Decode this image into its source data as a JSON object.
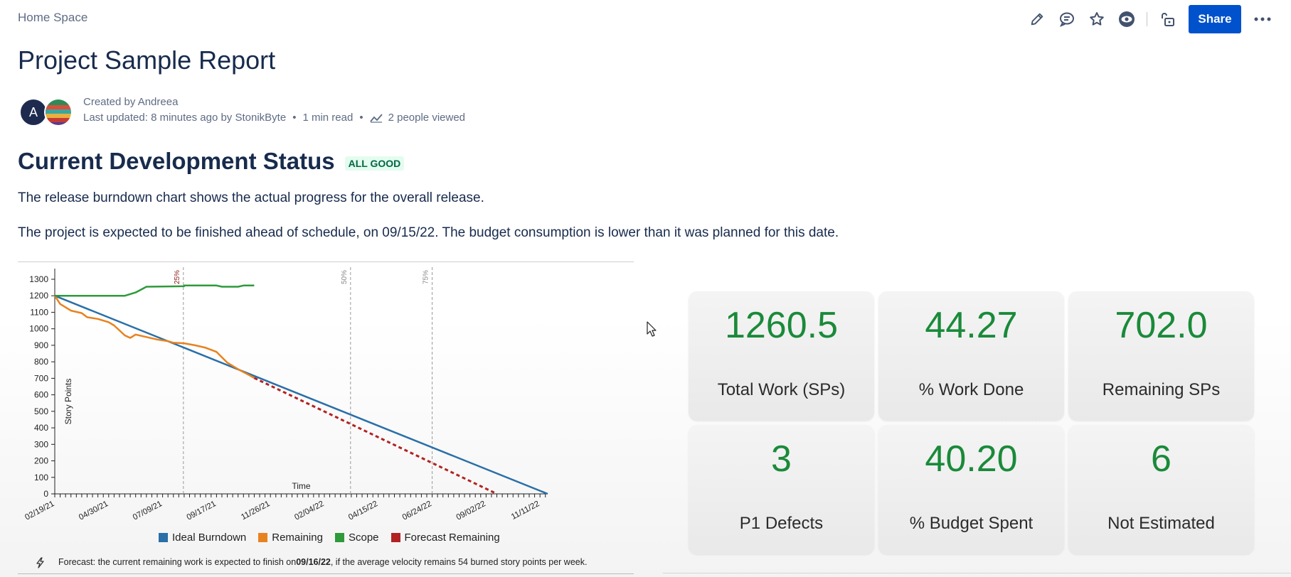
{
  "header": {
    "space_link": "Home Space",
    "share_label": "Share",
    "icons": [
      "edit-icon",
      "comment-icon",
      "star-icon",
      "watch-eye-icon",
      "unlock-icon",
      "more-icon"
    ]
  },
  "page": {
    "title": "Project Sample Report",
    "byline": {
      "avatar_initial": "A",
      "created": "Created by Andreea",
      "updated": "Last updated: 8 minutes ago by StonikByte",
      "read_time": "1 min read",
      "views": "2 people viewed"
    },
    "section_heading": "Current Development Status",
    "status_lozenge": "ALL GOOD",
    "status_colors": {
      "text": "#006644",
      "background": "#e3fcef"
    },
    "paragraph_1": "The release burndown chart shows the actual progress for the overall release.",
    "paragraph_2": "The project is expected to be finished ahead of schedule, on 09/15/22. The budget consumption is lower than it was planned for this date."
  },
  "chart_data": {
    "type": "line",
    "title": "",
    "xlabel": "Time",
    "ylabel": "Story Points",
    "ylim": [
      0,
      1300
    ],
    "yticks": [
      0,
      100,
      200,
      300,
      400,
      500,
      600,
      700,
      800,
      900,
      1000,
      1100,
      1200,
      1300
    ],
    "x_tick_labels": [
      "02/19/21",
      "04/30/21",
      "07/09/21",
      "09/17/21",
      "11/26/21",
      "02/04/22",
      "04/15/22",
      "06/24/22",
      "09/02/22",
      "11/11/22"
    ],
    "milestones": [
      {
        "label": "25%",
        "date": "08/05/21",
        "color": "#8b1a1a"
      },
      {
        "label": "50%",
        "date": "03/10/22",
        "color": "#888888"
      },
      {
        "label": "75%",
        "date": "06/24/22",
        "color": "#888888"
      }
    ],
    "grid": true,
    "legend_position": "bottom",
    "series": [
      {
        "name": "Ideal Burndown",
        "color": "#2a6fa8",
        "style": "solid",
        "points": [
          [
            "02/19/21",
            1200
          ],
          [
            "11/21/22",
            0
          ]
        ]
      },
      {
        "name": "Remaining",
        "color": "#e8821e",
        "style": "solid",
        "points": [
          [
            "02/19/21",
            1200
          ],
          [
            "02/26/21",
            1150
          ],
          [
            "03/12/21",
            1110
          ],
          [
            "03/26/21",
            1095
          ],
          [
            "04/02/21",
            1070
          ],
          [
            "04/16/21",
            1060
          ],
          [
            "04/30/21",
            1040
          ],
          [
            "05/07/21",
            1020
          ],
          [
            "05/14/21",
            990
          ],
          [
            "05/21/21",
            960
          ],
          [
            "05/28/21",
            945
          ],
          [
            "06/04/21",
            965
          ],
          [
            "06/18/21",
            950
          ],
          [
            "07/02/21",
            935
          ],
          [
            "07/16/21",
            925
          ],
          [
            "07/23/21",
            915
          ],
          [
            "08/06/21",
            912
          ],
          [
            "08/20/21",
            900
          ],
          [
            "09/03/21",
            885
          ],
          [
            "09/17/21",
            860
          ],
          [
            "10/01/21",
            795
          ],
          [
            "10/15/21",
            755
          ],
          [
            "10/29/21",
            720
          ],
          [
            "11/05/21",
            702
          ]
        ]
      },
      {
        "name": "Scope",
        "color": "#2e9a3a",
        "style": "solid",
        "points": [
          [
            "02/19/21",
            1200
          ],
          [
            "05/21/21",
            1200
          ],
          [
            "06/04/21",
            1220
          ],
          [
            "06/18/21",
            1255
          ],
          [
            "08/06/21",
            1258
          ],
          [
            "08/06/21",
            1262
          ],
          [
            "09/17/21",
            1262
          ],
          [
            "09/24/21",
            1255
          ],
          [
            "10/15/21",
            1255
          ],
          [
            "10/22/21",
            1262
          ],
          [
            "11/05/21",
            1262
          ]
        ]
      },
      {
        "name": "Forecast Remaining",
        "color": "#b22222",
        "style": "dashed",
        "points": [
          [
            "11/05/21",
            702
          ],
          [
            "09/16/22",
            0
          ]
        ]
      }
    ],
    "forecast_note_prefix": "Forecast: the current remaining work is expected to finish on ",
    "forecast_date": "09/16/22",
    "forecast_note_suffix": ", if the average velocity remains 54 burned story points per week."
  },
  "kpis": [
    {
      "value": "1260.5",
      "label": "Total Work (SPs)"
    },
    {
      "value": "44.27",
      "label": "% Work Done"
    },
    {
      "value": "702.0",
      "label": "Remaining SPs"
    },
    {
      "value": "3",
      "label": "P1 Defects"
    },
    {
      "value": "40.20",
      "label": "% Budget Spent"
    },
    {
      "value": "6",
      "label": "Not Estimated"
    }
  ],
  "kpi_value_color": "#1a8a3a",
  "brand_color": "#0052cc"
}
